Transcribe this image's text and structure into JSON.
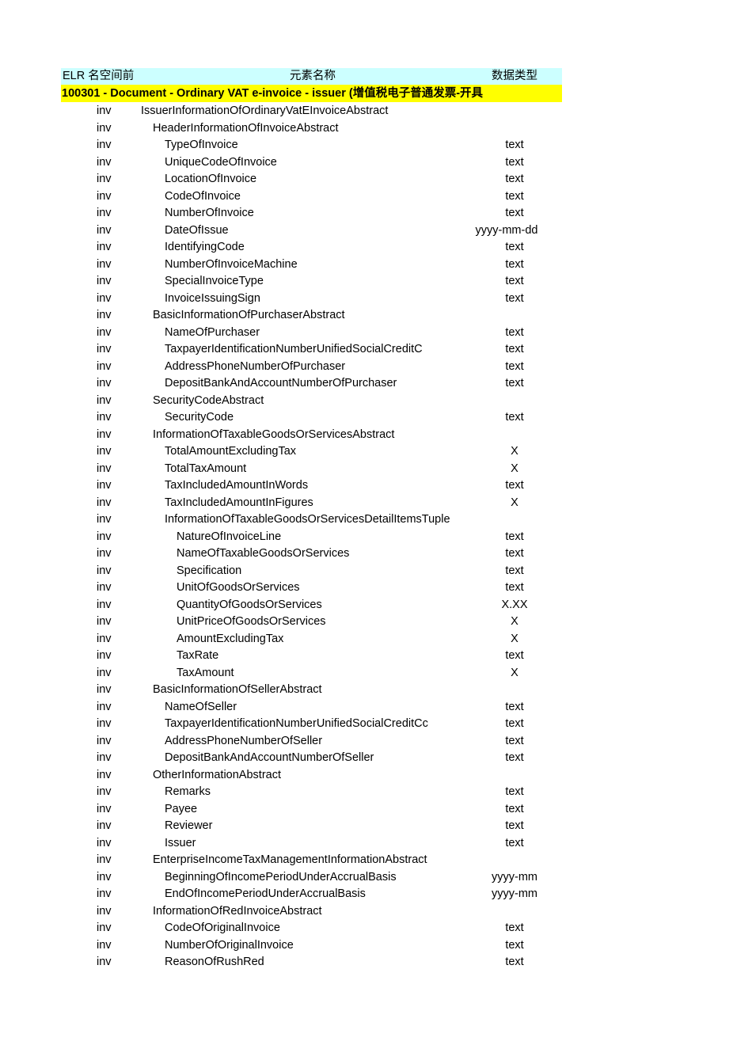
{
  "header": {
    "col_elr": "ELR  名空间前",
    "col_element": "元素名称",
    "col_datatype": "数据类型",
    "bg_color": "#ccffff"
  },
  "title_row": {
    "text": "100301 - Document - Ordinary VAT e-invoice - issuer   (增值税电子普通发票-开具",
    "bg_color": "#ffff00"
  },
  "namespace": "inv",
  "rows": [
    {
      "ns": "inv",
      "name": "IssuerInformationOfOrdinaryVatEInvoiceAbstract",
      "level": 0,
      "datatype": ""
    },
    {
      "ns": "inv",
      "name": "HeaderInformationOfInvoiceAbstract",
      "level": 1,
      "datatype": ""
    },
    {
      "ns": "inv",
      "name": "TypeOfInvoice",
      "level": 2,
      "datatype": "text"
    },
    {
      "ns": "inv",
      "name": "UniqueCodeOfInvoice",
      "level": 2,
      "datatype": "text"
    },
    {
      "ns": "inv",
      "name": "LocationOfInvoice",
      "level": 2,
      "datatype": "text"
    },
    {
      "ns": "inv",
      "name": "CodeOfInvoice",
      "level": 2,
      "datatype": "text"
    },
    {
      "ns": "inv",
      "name": "NumberOfInvoice",
      "level": 2,
      "datatype": "text"
    },
    {
      "ns": "inv",
      "name": "DateOfIssue",
      "level": 2,
      "datatype": "yyyy-mm-dd"
    },
    {
      "ns": "inv",
      "name": "IdentifyingCode",
      "level": 2,
      "datatype": "text"
    },
    {
      "ns": "inv",
      "name": "NumberOfInvoiceMachine",
      "level": 2,
      "datatype": "text"
    },
    {
      "ns": "inv",
      "name": "SpecialInvoiceType",
      "level": 2,
      "datatype": "text"
    },
    {
      "ns": "inv",
      "name": "InvoiceIssuingSign",
      "level": 2,
      "datatype": "text"
    },
    {
      "ns": "inv",
      "name": "BasicInformationOfPurchaserAbstract",
      "level": 1,
      "datatype": ""
    },
    {
      "ns": "inv",
      "name": "NameOfPurchaser",
      "level": 2,
      "datatype": "text"
    },
    {
      "ns": "inv",
      "name": "TaxpayerIdentificationNumberUnifiedSocialCreditC",
      "level": 2,
      "datatype": "text"
    },
    {
      "ns": "inv",
      "name": "AddressPhoneNumberOfPurchaser",
      "level": 2,
      "datatype": "text"
    },
    {
      "ns": "inv",
      "name": "DepositBankAndAccountNumberOfPurchaser",
      "level": 2,
      "datatype": "text"
    },
    {
      "ns": "inv",
      "name": "SecurityCodeAbstract",
      "level": 1,
      "datatype": ""
    },
    {
      "ns": "inv",
      "name": "SecurityCode",
      "level": 2,
      "datatype": "text"
    },
    {
      "ns": "inv",
      "name": "InformationOfTaxableGoodsOrServicesAbstract",
      "level": 1,
      "datatype": ""
    },
    {
      "ns": "inv",
      "name": "TotalAmountExcludingTax",
      "level": 2,
      "datatype": "X"
    },
    {
      "ns": "inv",
      "name": "TotalTaxAmount",
      "level": 2,
      "datatype": "X"
    },
    {
      "ns": "inv",
      "name": "TaxIncludedAmountInWords",
      "level": 2,
      "datatype": "text"
    },
    {
      "ns": "inv",
      "name": "TaxIncludedAmountInFigures",
      "level": 2,
      "datatype": "X"
    },
    {
      "ns": "inv",
      "name": "InformationOfTaxableGoodsOrServicesDetailItemsTuple",
      "level": 2,
      "datatype": ""
    },
    {
      "ns": "inv",
      "name": "NatureOfInvoiceLine",
      "level": 3,
      "datatype": "text"
    },
    {
      "ns": "inv",
      "name": "NameOfTaxableGoodsOrServices",
      "level": 3,
      "datatype": "text"
    },
    {
      "ns": "inv",
      "name": "Specification",
      "level": 3,
      "datatype": "text"
    },
    {
      "ns": "inv",
      "name": "UnitOfGoodsOrServices",
      "level": 3,
      "datatype": "text"
    },
    {
      "ns": "inv",
      "name": "QuantityOfGoodsOrServices",
      "level": 3,
      "datatype": "X.XX"
    },
    {
      "ns": "inv",
      "name": "UnitPriceOfGoodsOrServices",
      "level": 3,
      "datatype": "X"
    },
    {
      "ns": "inv",
      "name": "AmountExcludingTax",
      "level": 3,
      "datatype": "X"
    },
    {
      "ns": "inv",
      "name": "TaxRate",
      "level": 3,
      "datatype": "text"
    },
    {
      "ns": "inv",
      "name": "TaxAmount",
      "level": 3,
      "datatype": "X"
    },
    {
      "ns": "inv",
      "name": "BasicInformationOfSellerAbstract",
      "level": 1,
      "datatype": ""
    },
    {
      "ns": "inv",
      "name": "NameOfSeller",
      "level": 2,
      "datatype": "text"
    },
    {
      "ns": "inv",
      "name": "TaxpayerIdentificationNumberUnifiedSocialCreditCc",
      "level": 2,
      "datatype": "text"
    },
    {
      "ns": "inv",
      "name": "AddressPhoneNumberOfSeller",
      "level": 2,
      "datatype": "text"
    },
    {
      "ns": "inv",
      "name": "DepositBankAndAccountNumberOfSeller",
      "level": 2,
      "datatype": "text"
    },
    {
      "ns": "inv",
      "name": "OtherInformationAbstract",
      "level": 1,
      "datatype": ""
    },
    {
      "ns": "inv",
      "name": "Remarks",
      "level": 2,
      "datatype": "text"
    },
    {
      "ns": "inv",
      "name": "Payee",
      "level": 2,
      "datatype": "text"
    },
    {
      "ns": "inv",
      "name": "Reviewer",
      "level": 2,
      "datatype": "text"
    },
    {
      "ns": "inv",
      "name": "Issuer",
      "level": 2,
      "datatype": "text"
    },
    {
      "ns": "inv",
      "name": "EnterpriseIncomeTaxManagementInformationAbstract",
      "level": 1,
      "datatype": ""
    },
    {
      "ns": "inv",
      "name": "BeginningOfIncomePeriodUnderAccrualBasis",
      "level": 2,
      "datatype": "yyyy-mm"
    },
    {
      "ns": "inv",
      "name": "EndOfIncomePeriodUnderAccrualBasis",
      "level": 2,
      "datatype": "yyyy-mm"
    },
    {
      "ns": "inv",
      "name": "InformationOfRedInvoiceAbstract",
      "level": 1,
      "datatype": ""
    },
    {
      "ns": "inv",
      "name": "CodeOfOriginalInvoice",
      "level": 2,
      "datatype": "text"
    },
    {
      "ns": "inv",
      "name": "NumberOfOriginalInvoice",
      "level": 2,
      "datatype": "text"
    },
    {
      "ns": "inv",
      "name": "ReasonOfRushRed",
      "level": 2,
      "datatype": "text"
    }
  ]
}
